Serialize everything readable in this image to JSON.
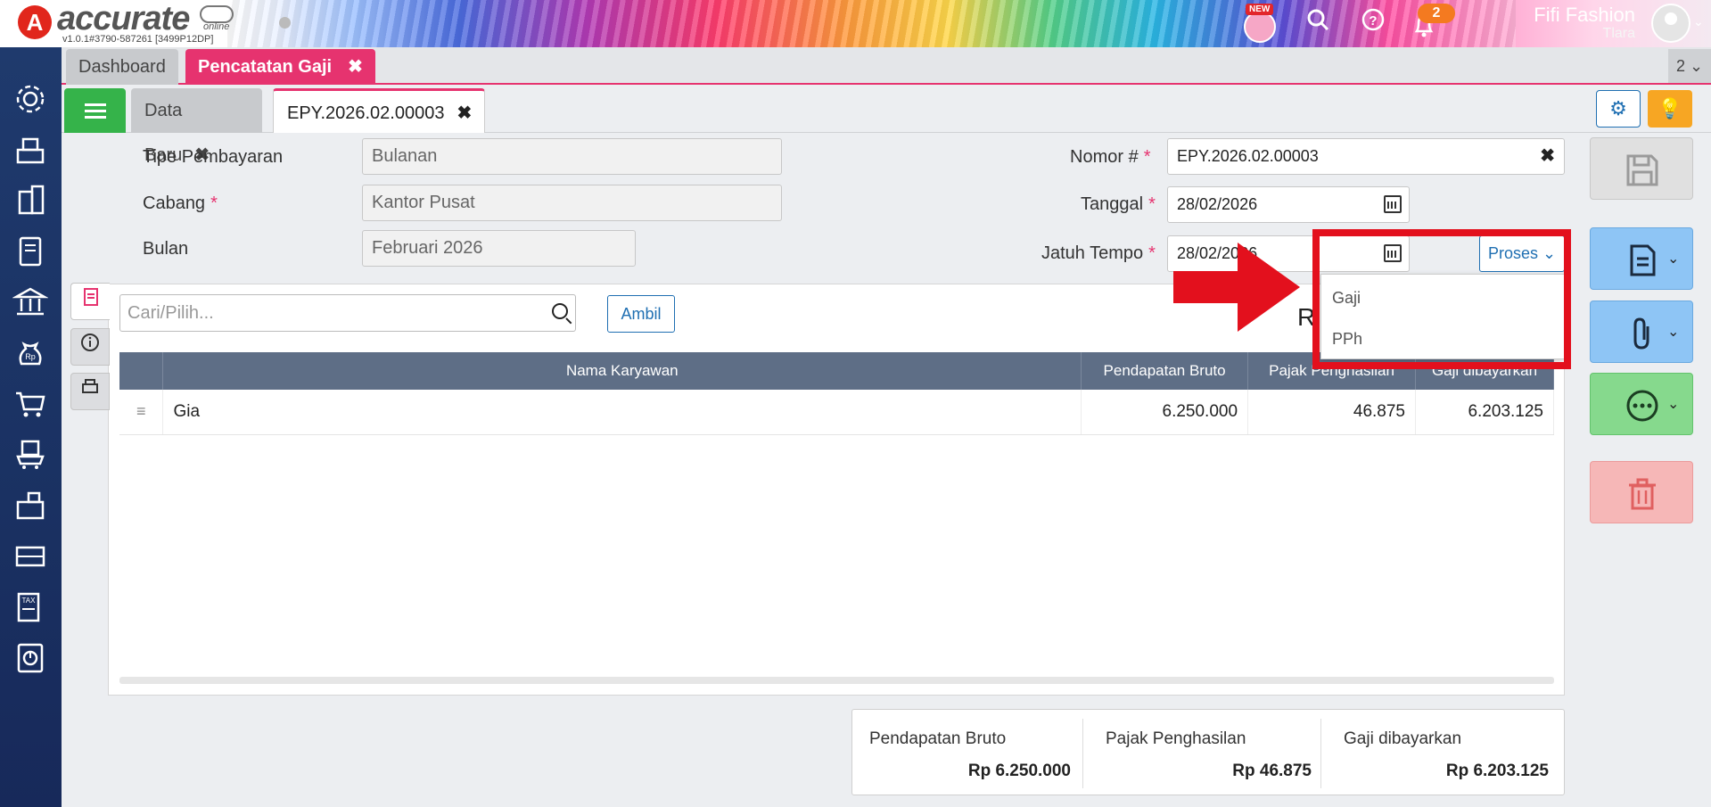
{
  "brand": {
    "logo_letter": "A",
    "name": "accurate",
    "sub": "online",
    "version": "v1.0.1#3790-587261 [3499P12DP]"
  },
  "header": {
    "new_badge": "NEW",
    "notif_count": "2",
    "company": "Fifi Fashion",
    "user": "Tlara"
  },
  "tabs_top": {
    "dashboard": "Dashboard",
    "active": "Pencatatan Gaji",
    "close": "✖",
    "count": "2 ⌄"
  },
  "tabs_doc": {
    "data_baru": "Data Baru",
    "epy": "EPY.2026.02.00003",
    "close": "✖"
  },
  "form": {
    "tipe_label": "Tipe Pembayaran",
    "tipe_value": "Bulanan",
    "cabang_label": "Cabang",
    "cabang_value": "Kantor Pusat",
    "bulan_label": "Bulan",
    "bulan_value": "Februari 2026",
    "nomor_label": "Nomor #",
    "nomor_value": "EPY.2026.02.00003",
    "tanggal_label": "Tanggal",
    "tanggal_value": "28/02/2026",
    "jatuh_label": "Jatuh Tempo",
    "jatuh_value": "28/02/2026",
    "required_mark": "*",
    "clear": "✖"
  },
  "proses": {
    "label": "Proses ⌄",
    "items": [
      "Gaji",
      "PPh"
    ]
  },
  "detail": {
    "search_placeholder": "Cari/Pilih...",
    "ambil": "Ambil",
    "partial_heading": "R",
    "columns": [
      "Nama Karyawan",
      "Pendapatan Bruto",
      "Pajak Penghasilan",
      "Gaji dibayarkan"
    ],
    "rows": [
      {
        "nama": "Gia",
        "bruto": "6.250.000",
        "pajak": "46.875",
        "gaji": "6.203.125"
      }
    ]
  },
  "totals": {
    "bruto_label": "Pendapatan Bruto",
    "bruto_value": "Rp 6.250.000",
    "pajak_label": "Pajak Penghasilan",
    "pajak_value": "Rp 46.875",
    "gaji_label": "Gaji dibayarkan",
    "gaji_value": "Rp 6.203.125"
  },
  "colors": {
    "accent": "#e6336f",
    "primary": "#1f6fb2",
    "sidebar": "#1f3a6d",
    "highlight": "#e3101d"
  }
}
